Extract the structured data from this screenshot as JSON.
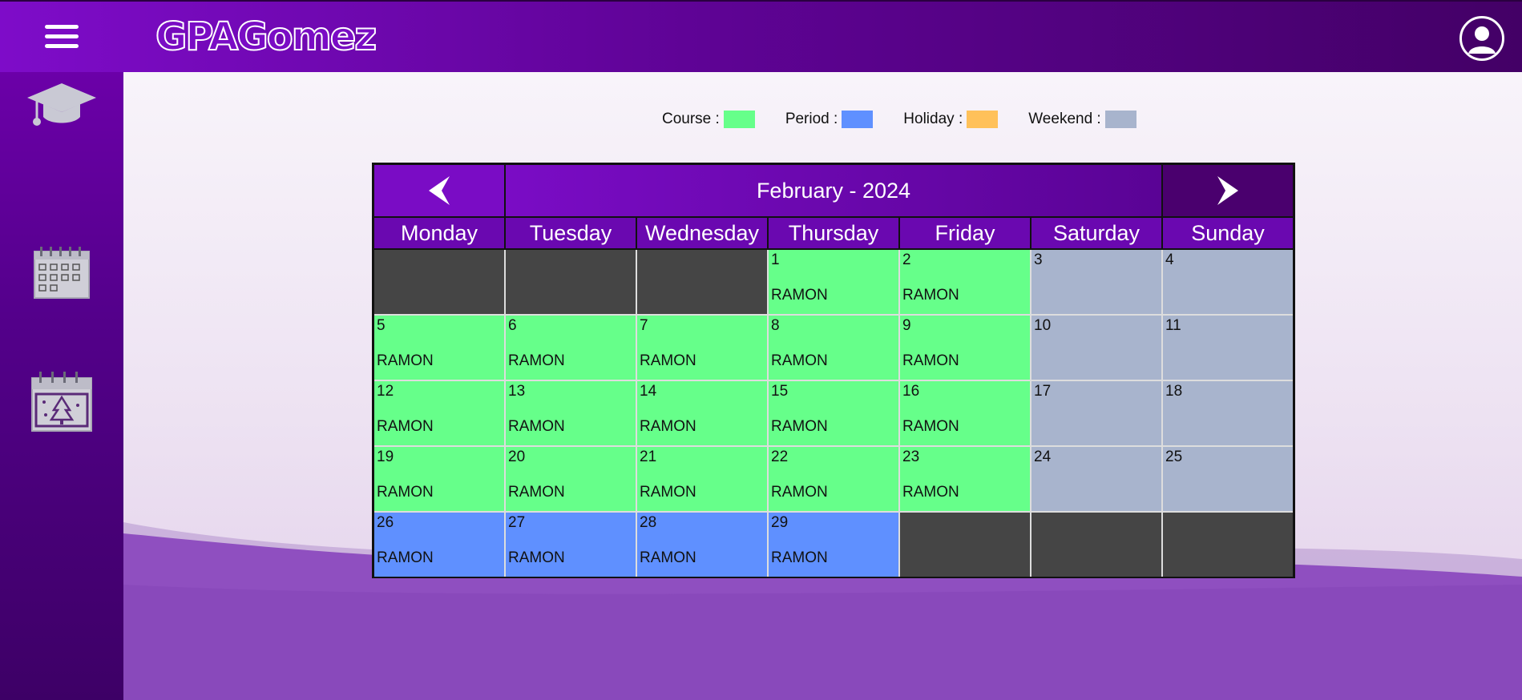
{
  "app": {
    "logo": "GPAGomez"
  },
  "legend": {
    "items": [
      {
        "label": "Course :",
        "color": "#66ff8a"
      },
      {
        "label": "Period :",
        "color": "#5f90ff"
      },
      {
        "label": "Holiday :",
        "color": "#ffc15a"
      },
      {
        "label": "Weekend :",
        "color": "#a8b4cd"
      }
    ]
  },
  "calendar": {
    "title": "February - 2024",
    "weekdays": [
      "Monday",
      "Tuesday",
      "Wednesday",
      "Thursday",
      "Friday",
      "Saturday",
      "Sunday"
    ],
    "days": [
      {
        "type": "empty"
      },
      {
        "type": "empty"
      },
      {
        "type": "empty"
      },
      {
        "day": "1",
        "type": "course",
        "name": "RAMON"
      },
      {
        "day": "2",
        "type": "course",
        "name": "RAMON"
      },
      {
        "day": "3",
        "type": "weekend"
      },
      {
        "day": "4",
        "type": "weekend"
      },
      {
        "day": "5",
        "type": "course",
        "name": "RAMON"
      },
      {
        "day": "6",
        "type": "course",
        "name": "RAMON"
      },
      {
        "day": "7",
        "type": "course",
        "name": "RAMON"
      },
      {
        "day": "8",
        "type": "course",
        "name": "RAMON"
      },
      {
        "day": "9",
        "type": "course",
        "name": "RAMON"
      },
      {
        "day": "10",
        "type": "weekend"
      },
      {
        "day": "11",
        "type": "weekend"
      },
      {
        "day": "12",
        "type": "course",
        "name": "RAMON"
      },
      {
        "day": "13",
        "type": "course",
        "name": "RAMON"
      },
      {
        "day": "14",
        "type": "course",
        "name": "RAMON"
      },
      {
        "day": "15",
        "type": "course",
        "name": "RAMON"
      },
      {
        "day": "16",
        "type": "course",
        "name": "RAMON"
      },
      {
        "day": "17",
        "type": "weekend"
      },
      {
        "day": "18",
        "type": "weekend"
      },
      {
        "day": "19",
        "type": "course",
        "name": "RAMON"
      },
      {
        "day": "20",
        "type": "course",
        "name": "RAMON"
      },
      {
        "day": "21",
        "type": "course",
        "name": "RAMON"
      },
      {
        "day": "22",
        "type": "course",
        "name": "RAMON"
      },
      {
        "day": "23",
        "type": "course",
        "name": "RAMON"
      },
      {
        "day": "24",
        "type": "weekend"
      },
      {
        "day": "25",
        "type": "weekend"
      },
      {
        "day": "26",
        "type": "period",
        "name": "RAMON"
      },
      {
        "day": "27",
        "type": "period",
        "name": "RAMON"
      },
      {
        "day": "28",
        "type": "period",
        "name": "RAMON"
      },
      {
        "day": "29",
        "type": "period",
        "name": "RAMON"
      },
      {
        "type": "empty"
      },
      {
        "type": "empty"
      },
      {
        "type": "empty"
      }
    ]
  },
  "sidebar": {
    "items": [
      {
        "icon": "graduation-cap-icon"
      },
      {
        "icon": "calendar-checklist-icon"
      },
      {
        "icon": "holiday-calendar-icon"
      }
    ]
  },
  "colors": {
    "primary": "#7a0cc5",
    "dark": "#430066",
    "course": "#66ff8a",
    "period": "#5f90ff",
    "holiday": "#ffc15a",
    "weekend": "#a8b4cd",
    "empty": "#454545"
  }
}
